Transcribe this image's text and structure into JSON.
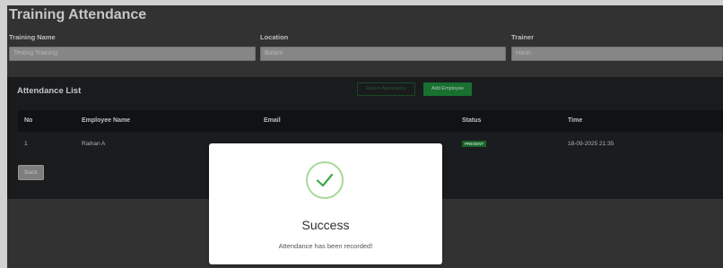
{
  "page": {
    "title": "Training Attendance"
  },
  "fields": {
    "training_name": {
      "label": "Training Name",
      "value": "Testing Training"
    },
    "location": {
      "label": "Location",
      "value": "Batam"
    },
    "trainer": {
      "label": "Trainer",
      "value": "Hann"
    }
  },
  "attendance": {
    "title": "Attendance List",
    "export_label": "Export Attendance",
    "add_label": "Add Employee",
    "columns": {
      "no": "No",
      "name": "Employee Name",
      "email": "Email",
      "status": "Status",
      "time": "Time"
    },
    "rows": [
      {
        "no": "1",
        "name": "Raihan A",
        "email": "",
        "status": "PRESENT",
        "time": "18-09-2025 21:35"
      }
    ],
    "back_label": "Back"
  },
  "modal": {
    "icon": "check-icon",
    "title": "Success",
    "message": "Attendance has been recorded!"
  },
  "colors": {
    "success": "#1f8a3c",
    "check": "#39a84a"
  }
}
